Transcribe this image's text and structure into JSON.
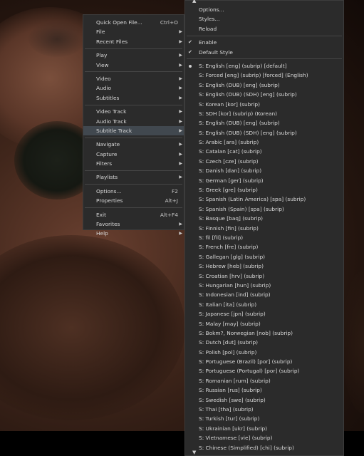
{
  "main_menu": {
    "items": [
      {
        "label": "Quick Open File...",
        "shortcut": "Ctrl+O",
        "submenu": false
      },
      {
        "label": "File",
        "submenu": true
      },
      {
        "label": "Recent Files",
        "submenu": true
      },
      {
        "label": "Play",
        "submenu": true
      },
      {
        "label": "View",
        "submenu": true
      },
      {
        "label": "Video",
        "submenu": true
      },
      {
        "label": "Audio",
        "submenu": true
      },
      {
        "label": "Subtitles",
        "submenu": true
      },
      {
        "label": "Video Track",
        "submenu": true
      },
      {
        "label": "Audio Track",
        "submenu": true
      },
      {
        "label": "Subtitle Track",
        "submenu": true,
        "active": true
      },
      {
        "label": "Navigate",
        "submenu": true
      },
      {
        "label": "Capture",
        "submenu": true
      },
      {
        "label": "Filters",
        "submenu": true
      },
      {
        "label": "Playlists",
        "submenu": true
      },
      {
        "label": "Options...",
        "shortcut": "F2"
      },
      {
        "label": "Properties",
        "shortcut": "Alt+J"
      },
      {
        "label": "Exit",
        "shortcut": "Alt+F4"
      },
      {
        "label": "Favorites",
        "submenu": true
      },
      {
        "label": "Help",
        "submenu": true
      }
    ]
  },
  "subtitle_menu": {
    "options_label": "Options...",
    "styles_label": "Styles...",
    "reload_label": "Reload",
    "enable_label": "Enable",
    "default_style_label": "Default Style",
    "tracks": [
      "S: English [eng] (subrip) [default]",
      "S: Forced [eng] (subrip) [forced] (English)",
      "S: English (DUB) [eng] (subrip)",
      "S: English (DUB) (SDH) [eng] (subrip)",
      "S: Korean [kor] (subrip)",
      "S: SDH [kor] (subrip) (Korean)",
      "S: English (DUB) [eng] (subrip)",
      "S: English (DUB) (SDH) [eng] (subrip)",
      "S: Arabic [ara] (subrip)",
      "S: Catalan [cat] (subrip)",
      "S: Czech [cze] (subrip)",
      "S: Danish [dan] (subrip)",
      "S: German [ger] (subrip)",
      "S: Greek [gre] (subrip)",
      "S: Spanish (Latin America) [spa] (subrip)",
      "S: Spanish (Spain) [spa] (subrip)",
      "S: Basque [baq] (subrip)",
      "S: Finnish [fin] (subrip)",
      "S: fil [fil] (subrip)",
      "S: French [fre] (subrip)",
      "S: Gallegan [glg] (subrip)",
      "S: Hebrew [heb] (subrip)",
      "S: Croatian [hrv] (subrip)",
      "S: Hungarian [hun] (subrip)",
      "S: Indonesian [ind] (subrip)",
      "S: Italian [ita] (subrip)",
      "S: Japanese [jpn] (subrip)",
      "S: Malay [may] (subrip)",
      "S: Bokm?, Norwegian [nob] (subrip)",
      "S: Dutch [dut] (subrip)",
      "S: Polish [pol] (subrip)",
      "S: Portuguese (Brazil) [por] (subrip)",
      "S: Portuguese (Portugal) [por] (subrip)",
      "S: Romanian [rum] (subrip)",
      "S: Russian [rus] (subrip)",
      "S: Swedish [swe] (subrip)",
      "S: Thai [tha] (subrip)",
      "S: Turkish [tur] (subrip)",
      "S: Ukrainian [ukr] (subrip)",
      "S: Vietnamese [vie] (subrip)",
      "S: Chinese (Simplified) [chi] (subrip)"
    ]
  },
  "colors": {
    "menu_bg": "#2b2b2b",
    "menu_highlight": "#41484f",
    "menu_text": "#d8d8d8"
  },
  "icons": {
    "submenu_arrow": "chevron-right-icon",
    "checked": "checkmark-icon",
    "selected_track": "radio-dot-icon",
    "scroll_up": "scroll-up-arrow-icon",
    "scroll_down": "scroll-down-arrow-icon"
  }
}
